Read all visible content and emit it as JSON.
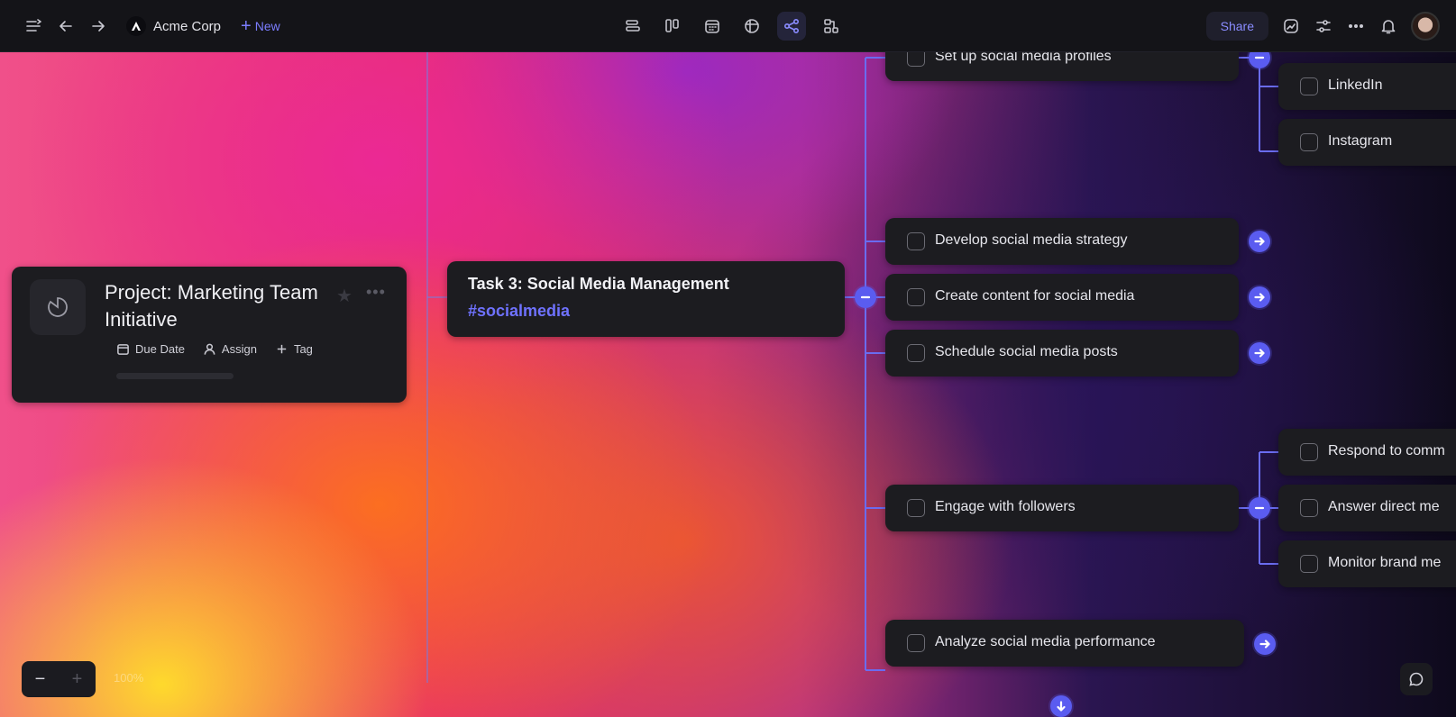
{
  "topbar": {
    "workspace": "Acme Corp",
    "new_label": "New",
    "share_label": "Share",
    "views": [
      "list-view",
      "board-view",
      "calendar-view",
      "table-view",
      "mindmap-view",
      "hierarchy-view"
    ],
    "active_view": "mindmap-view"
  },
  "project": {
    "title": "Project: Marketing Team Initiative",
    "actions": {
      "due_date": "Due Date",
      "assign": "Assign",
      "tag": "Tag"
    },
    "progress": 0
  },
  "task": {
    "title": "Task 3: Social Media Management",
    "tag": "#socialmedia"
  },
  "subtasks": [
    {
      "label": "Set up social media profiles",
      "children": [
        "LinkedIn",
        "Instagram"
      ]
    },
    {
      "label": "Develop social media strategy"
    },
    {
      "label": "Create content for social media"
    },
    {
      "label": "Schedule social media posts"
    },
    {
      "label": "Engage with followers",
      "children": [
        "Respond to comments",
        "Answer direct messages",
        "Monitor brand mentions"
      ]
    },
    {
      "label": "Analyze social media performance"
    }
  ],
  "visible_children": {
    "respond": "Respond to comm",
    "answer": "Answer direct me",
    "monitor": "Monitor brand me"
  },
  "zoom": {
    "value": "100%"
  },
  "colors": {
    "accent": "#5a5cf0",
    "link": "#6f72ff",
    "card": "#1c1c20"
  }
}
